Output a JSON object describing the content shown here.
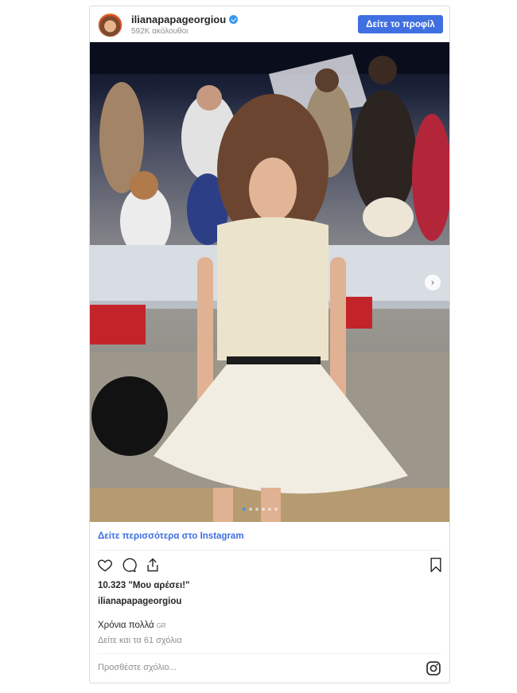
{
  "header": {
    "username": "ilianapapageorgiou",
    "followers": "592K ακόλουθοι",
    "profile_button": "Δείτε το προφίλ"
  },
  "media": {
    "description_icons": [
      "verified-icon",
      "chevron-right-icon"
    ],
    "carousel_count": 6,
    "carousel_active": 1
  },
  "see_more": "Δείτε περισσότερα στο Instagram",
  "actions": {
    "icons": [
      "heart-icon",
      "comment-icon",
      "share-icon",
      "bookmark-icon"
    ]
  },
  "likes": "10.323 \"Μου αρέσει!\"",
  "caption": {
    "username": "ilianapapageorgiou",
    "text": "Χρόνια πολλά",
    "flag": "GR"
  },
  "comments_link": "Δείτε και τα 61 σχόλια",
  "comment_input": {
    "placeholder": "Προσθέστε σχόλιο..."
  },
  "colors": {
    "accent": "#3f6fe0",
    "verified": "#3897f0",
    "muted": "#8e8e8e"
  }
}
